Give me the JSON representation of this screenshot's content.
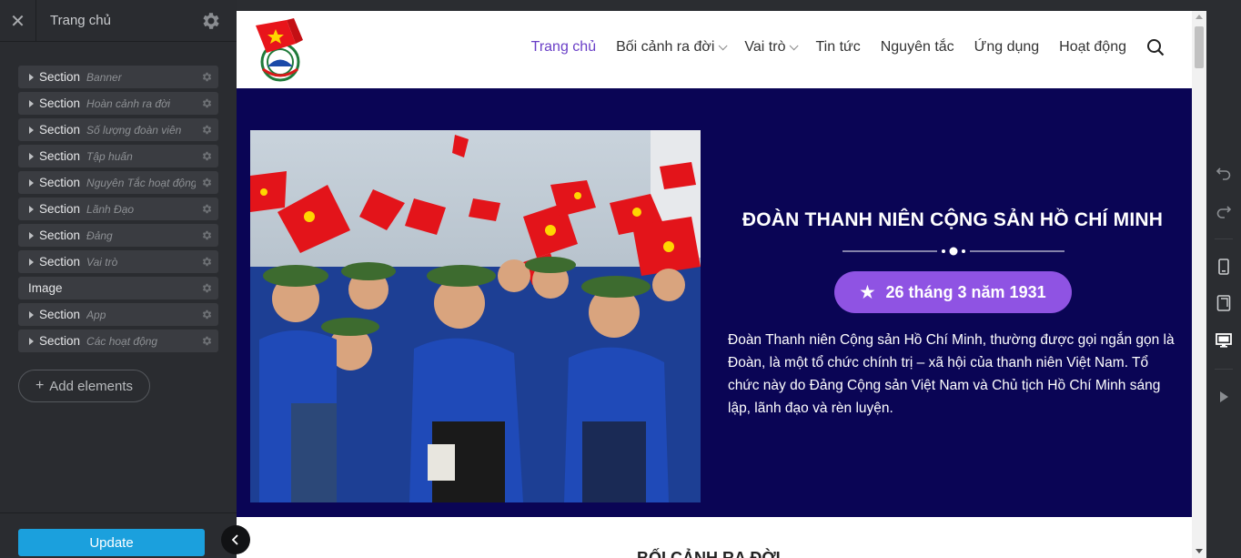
{
  "editor": {
    "page_title": "Trang chủ",
    "items": [
      {
        "type": "Section",
        "name": "Banner",
        "arrow": true
      },
      {
        "type": "Section",
        "name": "Hoàn cảnh ra đời",
        "arrow": true
      },
      {
        "type": "Section",
        "name": "Số lượng đoàn viên",
        "arrow": true
      },
      {
        "type": "Section",
        "name": "Tập huấn",
        "arrow": true
      },
      {
        "type": "Section",
        "name": "Nguyên Tắc hoạt động",
        "arrow": true
      },
      {
        "type": "Section",
        "name": "Lãnh Đạo",
        "arrow": true
      },
      {
        "type": "Section",
        "name": "Đảng",
        "arrow": true
      },
      {
        "type": "Section",
        "name": "Vai trò",
        "arrow": true
      },
      {
        "type": "Image",
        "name": "",
        "arrow": false
      },
      {
        "type": "Section",
        "name": "App",
        "arrow": true
      },
      {
        "type": "Section",
        "name": "Các hoạt động",
        "arrow": true
      }
    ],
    "add_elements_label": "Add elements",
    "add_elements_icon": "plus-icon",
    "update_label": "Update",
    "accent_color": "#1ba0dd"
  },
  "site": {
    "nav": [
      {
        "label": "Trang chủ",
        "active": true,
        "dropdown": false
      },
      {
        "label": "Bối cảnh ra đời",
        "active": false,
        "dropdown": true
      },
      {
        "label": "Vai trò",
        "active": false,
        "dropdown": true
      },
      {
        "label": "Tin tức",
        "active": false,
        "dropdown": false
      },
      {
        "label": "Nguyên tắc",
        "active": false,
        "dropdown": false
      },
      {
        "label": "Ứng dụng",
        "active": false,
        "dropdown": false
      },
      {
        "label": "Hoạt động",
        "active": false,
        "dropdown": false
      }
    ],
    "nav_active_color": "#6a3fc7",
    "banner": {
      "title": "ĐOÀN THANH NIÊN CỘNG SẢN HỒ CHÍ MINH",
      "date": "26 tháng 3 năm 1931",
      "date_icon": "star-icon",
      "description": "Đoàn Thanh niên Cộng sản Hồ Chí Minh, thường được gọi ngắn gọn là Đoàn, là một tổ chức chính trị – xã hội của thanh niên Việt Nam. Tổ chức này do Đảng Cộng sản Việt Nam và Chủ tịch Hồ Chí Minh sáng lập, lãnh đạo và rèn luyện.",
      "background_color": "#0a0555",
      "pill_color": "#8f53e3"
    },
    "next_section_title": "BỐI CẢNH RA ĐỜI"
  },
  "toolbar_icons": [
    "undo-icon",
    "redo-icon",
    "mobile-view-icon",
    "tablet-view-icon",
    "desktop-view-icon",
    "preview-play-icon"
  ]
}
